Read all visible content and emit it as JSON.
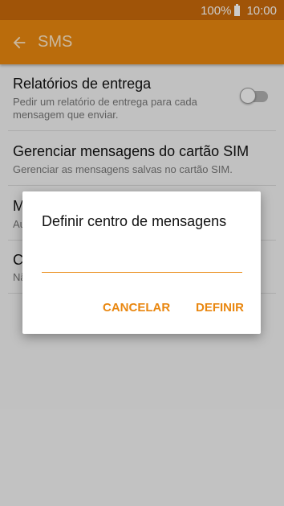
{
  "status_bar": {
    "battery_text": "100%",
    "time": "10:00"
  },
  "toolbar": {
    "title": "SMS",
    "back_icon": "arrow-left-icon"
  },
  "settings": [
    {
      "title": "Relatórios de entrega",
      "subtitle": "Pedir um relatório de entrega para cada mensagem que enviar.",
      "toggle": false
    },
    {
      "title": "Gerenciar mensagens do cartão SIM",
      "subtitle": "Gerenciar as mensagens salvas no cartão SIM."
    },
    {
      "title": "M",
      "subtitle": "Au"
    },
    {
      "title": "C",
      "subtitle": "Nã"
    }
  ],
  "dialog": {
    "title": "Definir centro de mensagens",
    "input_value": "",
    "cancel_label": "CANCELAR",
    "confirm_label": "DEFINIR"
  },
  "colors": {
    "status_bar": "#c8690b",
    "toolbar": "#e98710",
    "accent": "#e98710",
    "background": "#f2f2f2"
  }
}
